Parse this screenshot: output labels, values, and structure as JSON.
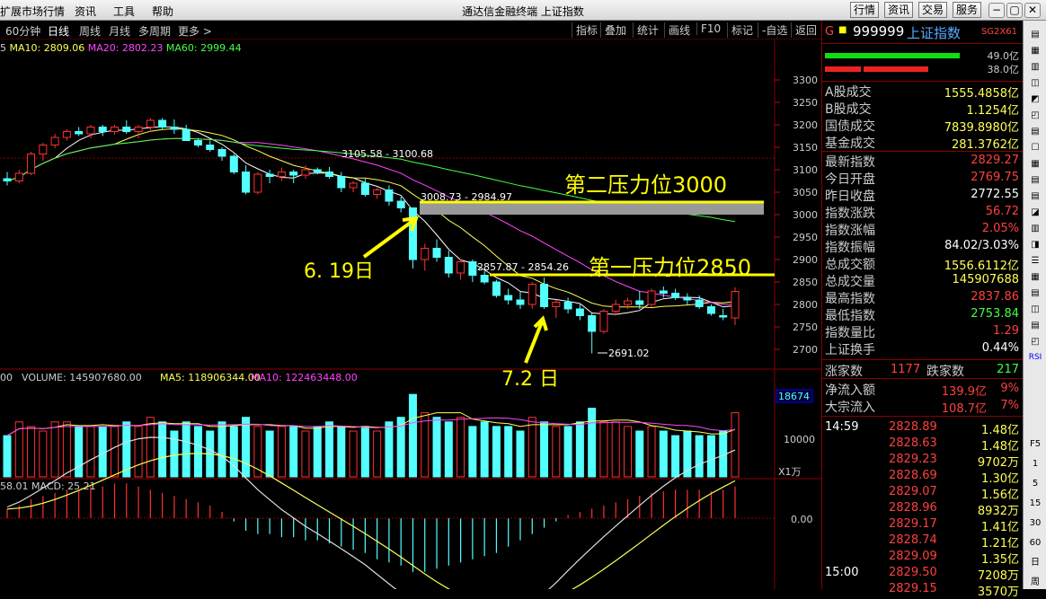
{
  "window": {
    "title": "通达信金融终端 上证指数",
    "menu": [
      "扩展市场行情",
      "资讯",
      "工具",
      "帮助"
    ],
    "top_tabs": [
      "行情",
      "资讯",
      "交易",
      "服务"
    ],
    "win_buttons": [
      "−",
      "▢",
      "✕"
    ]
  },
  "periods": [
    "60分钟",
    "日线",
    "周线",
    "月线",
    "多周期",
    "更多 >"
  ],
  "active_period": "日线",
  "toolbar": [
    "指标",
    "叠加",
    "统计",
    "画线",
    "F10",
    "标记",
    "-自选",
    "返回"
  ],
  "indicator_line": {
    "prefix": "5",
    "ma10": "MA10: 2809.06",
    "ma20": "MA20: 2802.23",
    "ma60": "MA60: 2999.44"
  },
  "price_axis": [
    "3300",
    "3250",
    "3200",
    "3150",
    "3100",
    "3050",
    "3000",
    "2950",
    "2900",
    "2850",
    "2800",
    "2750",
    "2700"
  ],
  "annotations": {
    "high_label": "3105.58 - 3100.68",
    "mid_label": "3008.73 - 2984.97",
    "low_gap_label": "2857.87 - 2854.26",
    "low_label": "2691.02",
    "resistance2": "第二压力位3000",
    "resistance1": "第一压力位2850",
    "date1": "6. 19日",
    "date2": "7.2 日"
  },
  "volume": {
    "header": "00",
    "vol": "VOLUME: 145907680.00",
    "ma5": "MA5: 118906344.00",
    "ma10": "MA10: 122463448.00",
    "axis_top": "18674",
    "axis_mid": "10000",
    "unit": "X1万"
  },
  "macd": {
    "header": "58.01",
    "label": "MACD: 25.21",
    "axis_zero": "0.00"
  },
  "quote": {
    "code": "999999",
    "name": "上证指数",
    "tag": "SG2X61",
    "g": "G",
    "up_amt": "49.0亿",
    "down_amt": "38.0亿",
    "rows1": [
      {
        "label": "A股成交",
        "value": "1555.4858亿",
        "color": "#ffff55"
      },
      {
        "label": "B股成交",
        "value": "1.1254亿",
        "color": "#ffff55"
      },
      {
        "label": "国债成交",
        "value": "7839.8980亿",
        "color": "#ffff55"
      },
      {
        "label": "基金成交",
        "value": "281.3762亿",
        "color": "#ffff55"
      }
    ],
    "rows2": [
      {
        "label": "最新指数",
        "value": "2829.27",
        "color": "#ff4040"
      },
      {
        "label": "今日开盘",
        "value": "2769.75",
        "color": "#ff4040"
      },
      {
        "label": "昨日收盘",
        "value": "2772.55",
        "color": "#ffffff"
      },
      {
        "label": "指数涨跌",
        "value": "56.72",
        "color": "#ff4040"
      },
      {
        "label": "指数涨幅",
        "value": "2.05%",
        "color": "#ff4040"
      },
      {
        "label": "指数振幅",
        "value": "84.02/3.03%",
        "color": "#ffffff"
      },
      {
        "label": "总成交额",
        "value": "1556.6112亿",
        "color": "#ffff55"
      },
      {
        "label": "总成交量",
        "value": "145907688",
        "color": "#ffff55"
      },
      {
        "label": "最高指数",
        "value": "2837.86",
        "color": "#ff4040"
      },
      {
        "label": "最低指数",
        "value": "2753.84",
        "color": "#40ff40"
      },
      {
        "label": "指数量比",
        "value": "1.29",
        "color": "#ff4040"
      },
      {
        "label": "上证换手",
        "value": "0.44%",
        "color": "#ffffff"
      }
    ],
    "breadth": {
      "up_label": "涨家数",
      "up": "1177",
      "down_label": "跌家数",
      "down": "217"
    },
    "flows": [
      {
        "label": "净流入额",
        "value": "139.9亿",
        "pct": "9%"
      },
      {
        "label": "大宗流入",
        "value": "108.7亿",
        "pct": "7%"
      }
    ],
    "ticks": [
      {
        "time": "14:59",
        "price": "2828.89",
        "vol": "1.48亿"
      },
      {
        "time": "",
        "price": "2828.63",
        "vol": "1.48亿"
      },
      {
        "time": "",
        "price": "2829.23",
        "vol": "9702万"
      },
      {
        "time": "",
        "price": "2828.69",
        "vol": "1.30亿"
      },
      {
        "time": "",
        "price": "2829.07",
        "vol": "1.56亿"
      },
      {
        "time": "",
        "price": "2828.96",
        "vol": "8932万"
      },
      {
        "time": "",
        "price": "2829.17",
        "vol": "1.41亿"
      },
      {
        "time": "",
        "price": "2828.74",
        "vol": "1.21亿"
      },
      {
        "time": "",
        "price": "2829.09",
        "vol": "1.35亿"
      },
      {
        "time": "15:00",
        "price": "2829.50",
        "vol": "7208万"
      },
      {
        "time": "",
        "price": "2829.15",
        "vol": "3570万"
      }
    ]
  },
  "side_tools": [
    "F5",
    "1",
    "5",
    "15",
    "30",
    "60",
    "日",
    "周"
  ],
  "chart_data": {
    "type": "candlestick",
    "ohlc": [
      [
        3080,
        3095,
        3065,
        3075
      ],
      [
        3075,
        3100,
        3070,
        3092
      ],
      [
        3092,
        3140,
        3088,
        3135
      ],
      [
        3135,
        3160,
        3120,
        3155
      ],
      [
        3155,
        3180,
        3148,
        3172
      ],
      [
        3172,
        3190,
        3165,
        3185
      ],
      [
        3185,
        3195,
        3175,
        3180
      ],
      [
        3180,
        3200,
        3170,
        3195
      ],
      [
        3195,
        3200,
        3175,
        3185
      ],
      [
        3185,
        3200,
        3178,
        3195
      ],
      [
        3195,
        3210,
        3180,
        3185
      ],
      [
        3185,
        3200,
        3170,
        3195
      ],
      [
        3195,
        3215,
        3185,
        3210
      ],
      [
        3210,
        3215,
        3190,
        3195
      ],
      [
        3195,
        3212,
        3180,
        3190
      ],
      [
        3190,
        3200,
        3170,
        3165
      ],
      [
        3165,
        3170,
        3150,
        3155
      ],
      [
        3155,
        3165,
        3140,
        3145
      ],
      [
        3145,
        3150,
        3120,
        3130
      ],
      [
        3130,
        3135,
        3090,
        3095
      ],
      [
        3095,
        3110,
        3045,
        3050
      ],
      [
        3050,
        3095,
        3045,
        3090
      ],
      [
        3090,
        3100,
        3070,
        3085
      ],
      [
        3085,
        3105,
        3075,
        3095
      ],
      [
        3095,
        3100,
        3070,
        3088
      ],
      [
        3088,
        3110,
        3080,
        3100
      ],
      [
        3100,
        3105,
        3090,
        3095
      ],
      [
        3095,
        3106,
        3080,
        3085
      ],
      [
        3085,
        3095,
        3050,
        3060
      ],
      [
        3060,
        3075,
        3050,
        3070
      ],
      [
        3070,
        3080,
        3040,
        3045
      ],
      [
        3045,
        3060,
        3035,
        3055
      ],
      [
        3055,
        3065,
        3020,
        3030
      ],
      [
        3030,
        3040,
        3005,
        3015
      ],
      [
        3015,
        3009,
        2880,
        2900
      ],
      [
        2900,
        2935,
        2875,
        2925
      ],
      [
        2925,
        2945,
        2895,
        2905
      ],
      [
        2905,
        2920,
        2860,
        2870
      ],
      [
        2870,
        2900,
        2855,
        2895
      ],
      [
        2895,
        2900,
        2850,
        2865
      ],
      [
        2865,
        2875,
        2845,
        2850
      ],
      [
        2850,
        2855,
        2815,
        2820
      ],
      [
        2820,
        2835,
        2800,
        2810
      ],
      [
        2810,
        2830,
        2790,
        2800
      ],
      [
        2800,
        2850,
        2790,
        2845
      ],
      [
        2845,
        2860,
        2790,
        2795
      ],
      [
        2795,
        2810,
        2770,
        2805
      ],
      [
        2805,
        2815,
        2780,
        2790
      ],
      [
        2790,
        2800,
        2765,
        2775
      ],
      [
        2775,
        2780,
        2691,
        2740
      ],
      [
        2740,
        2790,
        2735,
        2785
      ],
      [
        2785,
        2810,
        2775,
        2800
      ],
      [
        2800,
        2815,
        2790,
        2808
      ],
      [
        2808,
        2830,
        2790,
        2800
      ],
      [
        2800,
        2835,
        2795,
        2830
      ],
      [
        2830,
        2840,
        2815,
        2825
      ],
      [
        2825,
        2835,
        2810,
        2815
      ],
      [
        2815,
        2825,
        2800,
        2810
      ],
      [
        2810,
        2820,
        2790,
        2795
      ],
      [
        2795,
        2800,
        2775,
        2780
      ],
      [
        2775,
        2790,
        2765,
        2772
      ],
      [
        2770,
        2838,
        2754,
        2829
      ]
    ],
    "price_range": [
      2670,
      3330
    ],
    "volume": [
      9,
      12,
      11,
      10,
      12,
      12,
      11,
      11,
      11,
      11,
      12,
      11,
      13,
      12,
      10,
      12,
      11,
      10,
      12,
      11,
      13,
      11,
      10,
      11,
      11,
      10,
      11,
      12,
      11,
      10,
      11,
      10,
      12,
      13,
      18,
      14,
      13,
      12,
      13,
      11,
      12,
      11,
      11,
      10,
      13,
      12,
      11,
      11,
      12,
      15,
      12,
      12,
      11,
      10,
      11,
      10,
      9,
      10,
      9,
      9,
      10,
      14
    ],
    "volume_range": [
      0,
      20
    ],
    "macd_hist": [
      6,
      8,
      12,
      14,
      16,
      18,
      18,
      20,
      20,
      22,
      22,
      20,
      18,
      16,
      14,
      12,
      10,
      8,
      4,
      -2,
      -8,
      -10,
      -10,
      -12,
      -12,
      -14,
      -14,
      -16,
      -18,
      -20,
      -22,
      -26,
      -28,
      -30,
      -34,
      -34,
      -32,
      -30,
      -28,
      -26,
      -24,
      -22,
      -18,
      -14,
      -10,
      -6,
      -2,
      2,
      4,
      6,
      8,
      10,
      12,
      14,
      16,
      17,
      18,
      18,
      18,
      17,
      18,
      20
    ],
    "macd_range": [
      -40,
      30
    ]
  }
}
